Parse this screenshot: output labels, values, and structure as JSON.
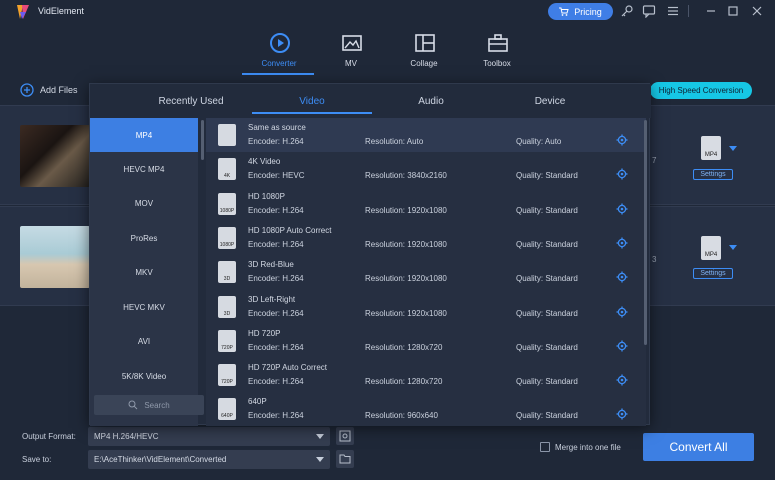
{
  "app": {
    "title": "VidElement",
    "pricing": "Pricing"
  },
  "nav": [
    {
      "label": "Converter",
      "icon": "converter-icon",
      "active": true
    },
    {
      "label": "MV",
      "icon": "mv-icon",
      "active": false
    },
    {
      "label": "Collage",
      "icon": "collage-icon",
      "active": false
    },
    {
      "label": "Toolbox",
      "icon": "toolbox-icon",
      "active": false
    }
  ],
  "toolbar": {
    "add_files": "Add Files",
    "high_speed": "High Speed Conversion"
  },
  "files": [
    {
      "side_digit": "7",
      "format_icon": "MP4",
      "settings": "Settings"
    },
    {
      "side_digit": "3",
      "format_icon": "MP4",
      "settings": "Settings"
    }
  ],
  "popup": {
    "tabs": [
      "Recently Used",
      "Video",
      "Audio",
      "Device"
    ],
    "active_tab": "Video",
    "categories": [
      "MP4",
      "HEVC MP4",
      "MOV",
      "ProRes",
      "MKV",
      "HEVC MKV",
      "AVI",
      "5K/8K Video"
    ],
    "search_placeholder": "Search",
    "formats": [
      {
        "name": "Same as source",
        "encoder": "Encoder: H.264",
        "resolution": "Resolution: Auto",
        "quality": "Quality: Auto",
        "icon_label": "",
        "active": true
      },
      {
        "name": "4K Video",
        "encoder": "Encoder: HEVC",
        "resolution": "Resolution: 3840x2160",
        "quality": "Quality: Standard",
        "icon_label": "4K"
      },
      {
        "name": "HD 1080P",
        "encoder": "Encoder: H.264",
        "resolution": "Resolution: 1920x1080",
        "quality": "Quality: Standard",
        "icon_label": "1080P"
      },
      {
        "name": "HD 1080P Auto Correct",
        "encoder": "Encoder: H.264",
        "resolution": "Resolution: 1920x1080",
        "quality": "Quality: Standard",
        "icon_label": "1080P"
      },
      {
        "name": "3D Red-Blue",
        "encoder": "Encoder: H.264",
        "resolution": "Resolution: 1920x1080",
        "quality": "Quality: Standard",
        "icon_label": "3D"
      },
      {
        "name": "3D Left-Right",
        "encoder": "Encoder: H.264",
        "resolution": "Resolution: 1920x1080",
        "quality": "Quality: Standard",
        "icon_label": "3D"
      },
      {
        "name": "HD 720P",
        "encoder": "Encoder: H.264",
        "resolution": "Resolution: 1280x720",
        "quality": "Quality: Standard",
        "icon_label": "720P"
      },
      {
        "name": "HD 720P Auto Correct",
        "encoder": "Encoder: H.264",
        "resolution": "Resolution: 1280x720",
        "quality": "Quality: Standard",
        "icon_label": "720P"
      },
      {
        "name": "640P",
        "encoder": "Encoder: H.264",
        "resolution": "Resolution: 960x640",
        "quality": "Quality: Standard",
        "icon_label": "640P"
      }
    ]
  },
  "bottom": {
    "output_format_label": "Output Format:",
    "output_format_value": "MP4 H.264/HEVC",
    "save_to_label": "Save to:",
    "save_to_value": "E:\\AceThinker\\VidElement\\Converted",
    "merge_label": "Merge into one file",
    "convert_all": "Convert All"
  },
  "colors": {
    "accent": "#3d8df5",
    "button": "#3d7fe3",
    "badge": "#16c7e5",
    "bg": "#1f2838"
  }
}
